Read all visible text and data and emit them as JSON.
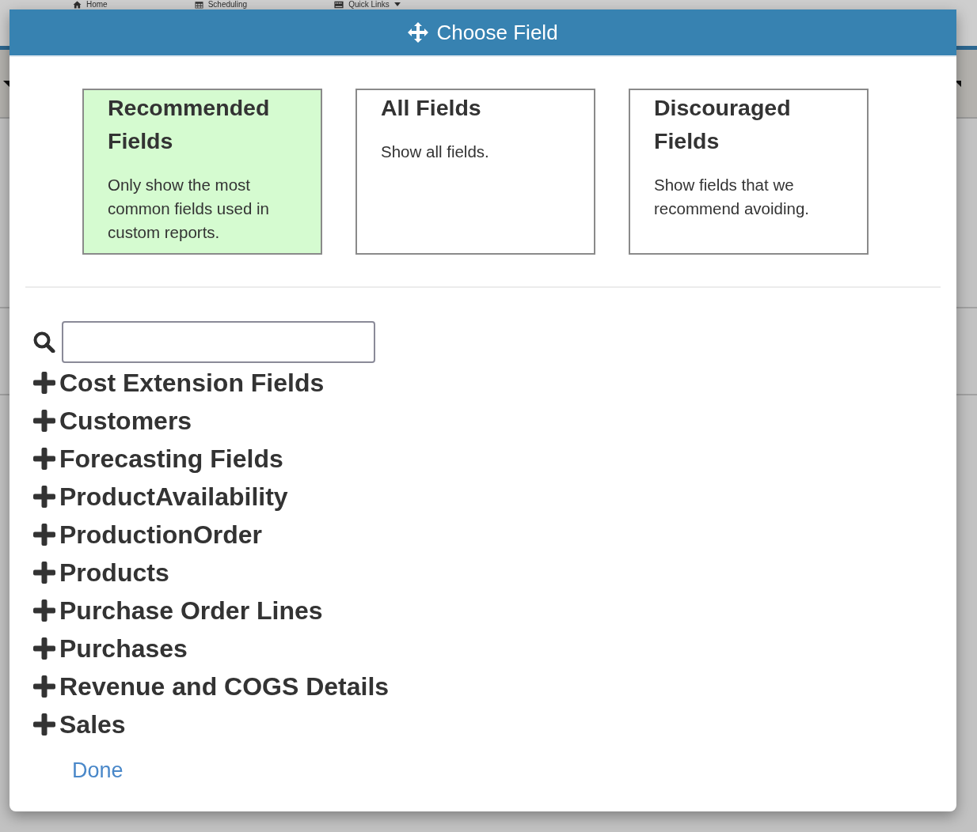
{
  "background_page": {
    "nav": [
      {
        "label": "Home",
        "dropdown": false
      },
      {
        "label": "Scheduling",
        "dropdown": false
      },
      {
        "label": "Quick Links",
        "dropdown": true
      }
    ]
  },
  "dialog": {
    "title": "Choose Field",
    "modes": [
      {
        "title": "Recommended Fields",
        "description": "Only show the most common fields used in custom reports.",
        "selected": true
      },
      {
        "title": "All Fields",
        "description": "Show all fields.",
        "selected": false
      },
      {
        "title": "Discouraged Fields",
        "description": "Show fields that we recommend avoiding.",
        "selected": false
      }
    ],
    "field_groups": [
      {
        "label": "Cost Extension Fields",
        "expanded": false
      },
      {
        "label": "Customers",
        "expanded": false
      },
      {
        "label": "Forecasting Fields",
        "expanded": false
      },
      {
        "label": "ProductAvailability",
        "expanded": false
      },
      {
        "label": "ProductionOrder",
        "expanded": false
      },
      {
        "label": "Products",
        "expanded": false
      },
      {
        "label": "Purchase Order Lines",
        "expanded": false
      },
      {
        "label": "Purchases",
        "expanded": false
      },
      {
        "label": "Revenue and COGS Details",
        "expanded": false
      },
      {
        "label": "Sales",
        "expanded": false
      }
    ],
    "done_link": "Done"
  }
}
